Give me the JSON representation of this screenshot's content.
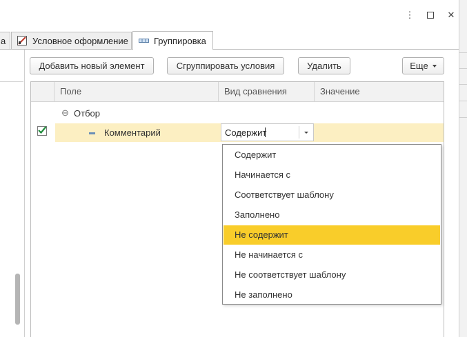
{
  "window": {
    "more_icon": "vertical-dots-icon",
    "maximize_icon": "square-icon",
    "close_icon": "close-icon",
    "close_glyph": "✕",
    "more_glyph": "⋮"
  },
  "tabs": [
    {
      "label": "а",
      "active": false
    },
    {
      "label": "Условное оформление",
      "icon": "conditional-format-icon",
      "active": false
    },
    {
      "label": "Группировка",
      "icon": "grouping-icon",
      "active": true
    }
  ],
  "toolbar": {
    "add_label": "Добавить новый элемент",
    "group_label": "Сгруппировать условия",
    "delete_label": "Удалить",
    "more_label": "Еще"
  },
  "grid": {
    "columns": [
      "Поле",
      "Вид сравнения",
      "Значение"
    ],
    "group_row": {
      "label": "Отбор",
      "expander": "⊖"
    },
    "item_row": {
      "field": "Комментарий",
      "comparison": "Содержит",
      "checked": true
    }
  },
  "dropdown": {
    "options": [
      "Содержит",
      "Начинается с",
      "Соответствует шаблону",
      "Заполнено",
      "Не содержит",
      "Не начинается с",
      "Не соответствует шаблону",
      "Не заполнено"
    ],
    "highlighted_index": 4
  },
  "colors": {
    "highlight": "#f9cd2a",
    "selected_row": "#fcefc2",
    "check_green": "#1e8a3a"
  }
}
